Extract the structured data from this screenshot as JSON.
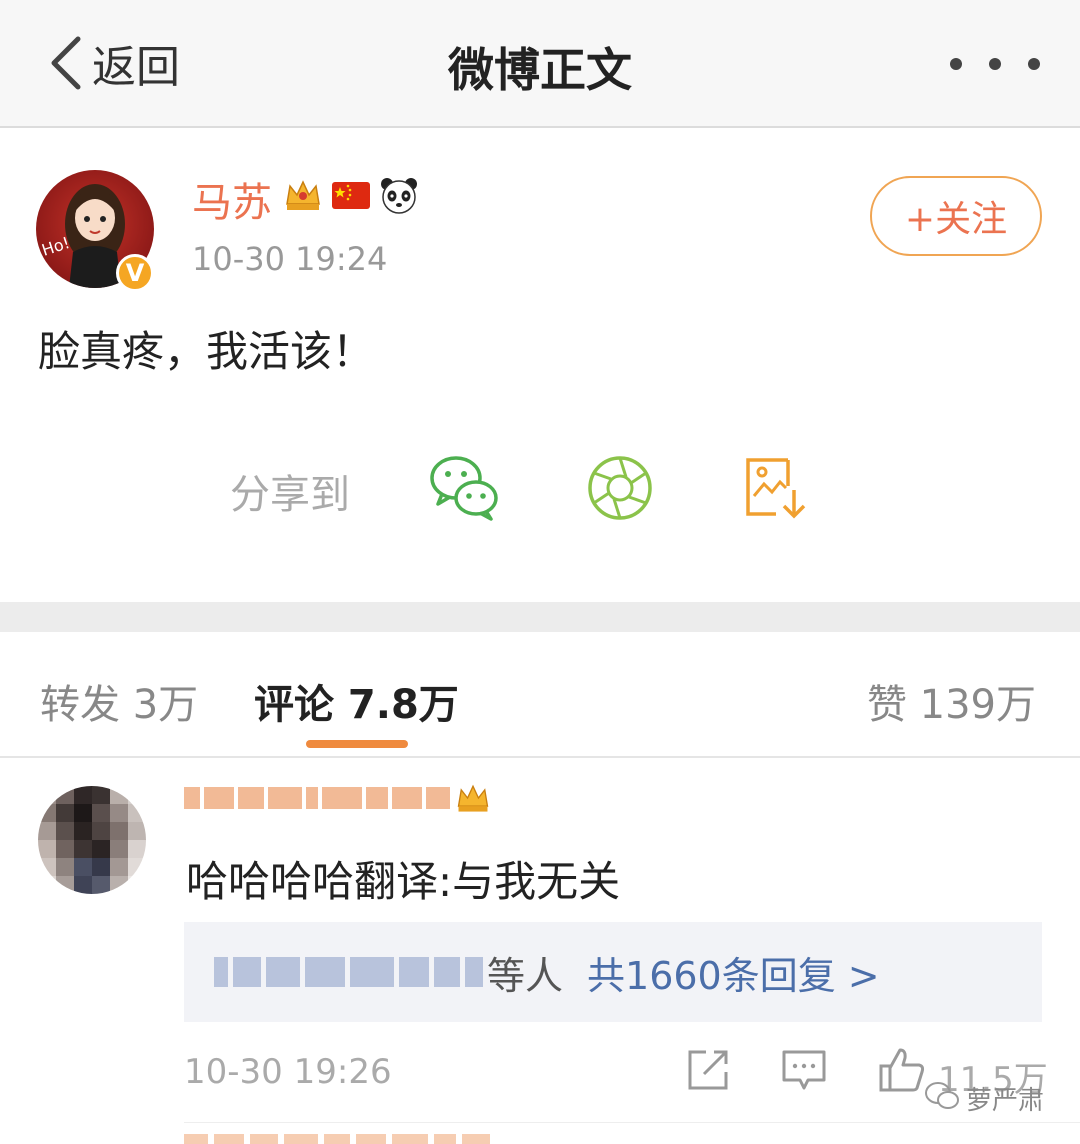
{
  "nav": {
    "back_label": "返回",
    "title": "微博正文"
  },
  "post": {
    "username": "马苏",
    "time": "10-30 19:24",
    "follow_label": "+关注",
    "text": "脸真疼，我活该！",
    "badges": [
      "crown-icon",
      "china-flag-icon",
      "panda-icon"
    ]
  },
  "share": {
    "label": "分享到",
    "targets": [
      "wechat-icon",
      "moments-icon",
      "save-image-icon"
    ]
  },
  "tabs": {
    "repost": "转发 3万",
    "comments": "评论 7.8万",
    "likes": "赞 139万",
    "active": "comments"
  },
  "comment": {
    "text": "哈哈哈哈翻译:与我无关",
    "reply_person_suffix": "等人",
    "reply_count": "共1660条回复 >",
    "time": "10-30 19:26",
    "likes": "11.5万"
  },
  "watermark": {
    "text": "萝严肃"
  },
  "colors": {
    "accent_orange": "#eb7350",
    "link_blue": "#4b6ea9",
    "wechat_green": "#4caf50",
    "moments_green": "#8bc34a",
    "save_orange": "#f0a030"
  }
}
